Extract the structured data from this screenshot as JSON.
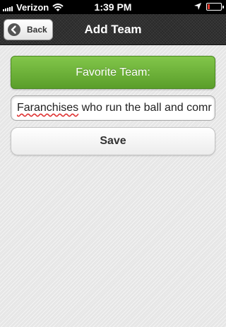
{
  "status_bar": {
    "carrier": "Verizon",
    "time": "1:39 PM",
    "battery_level": 0.15,
    "battery_color": "#e23a2d"
  },
  "nav": {
    "title": "Add Team",
    "back_label": "Back",
    "back_icon": "back-arrow-circle-icon"
  },
  "form": {
    "header": "Favorite Team:",
    "input_value_misspelled": "Faranchises",
    "input_value_rest": " who run the ball and comr",
    "save_label": "Save",
    "header_color": "#6aae35"
  }
}
